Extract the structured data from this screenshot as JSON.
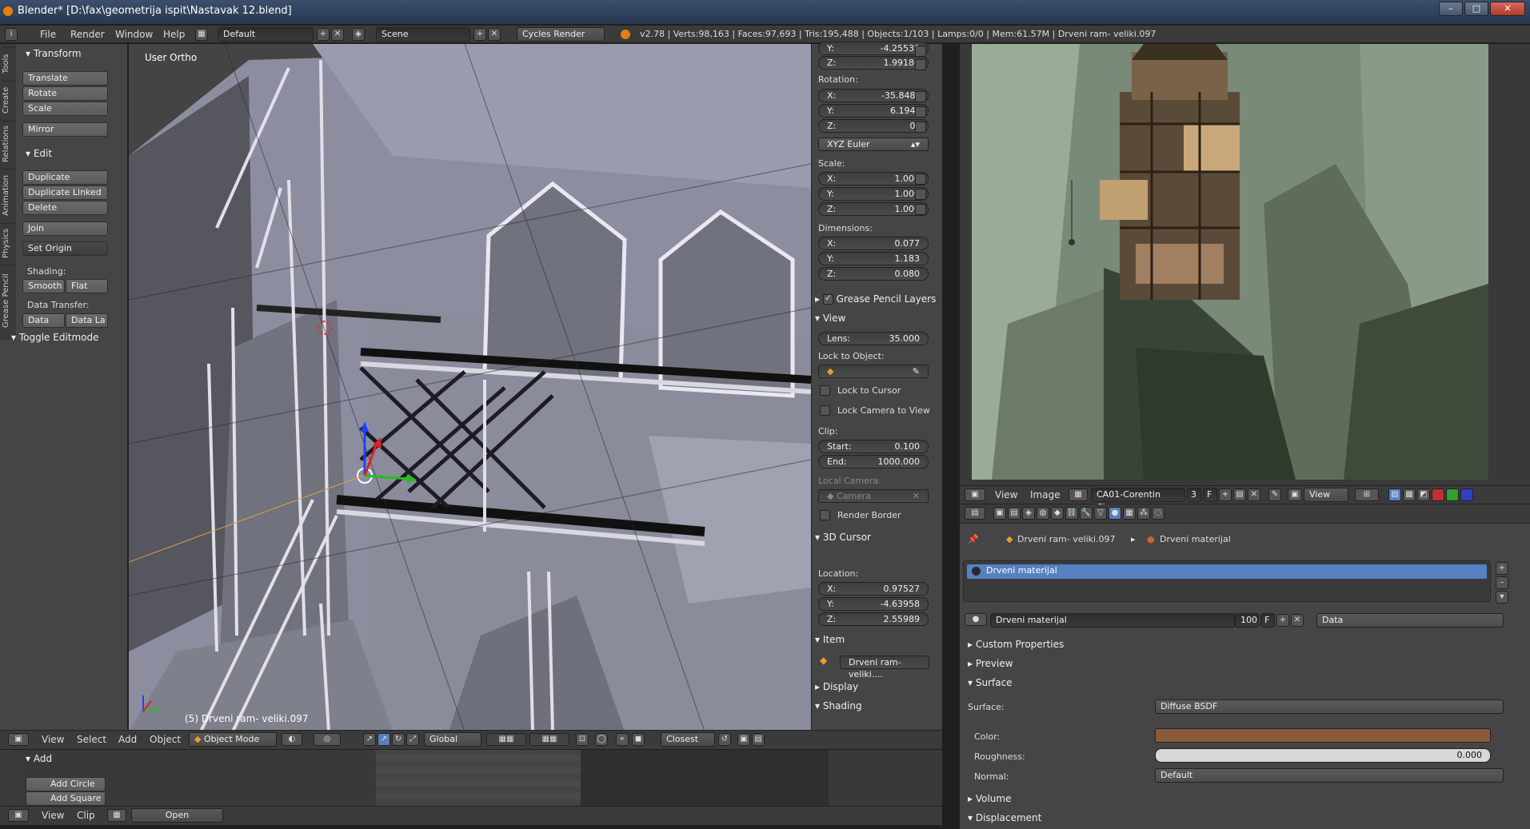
{
  "window": {
    "title": "Blender* [D:\\fax\\geometrija ispit\\Nastavak 12.blend]"
  },
  "infobar": {
    "menus": [
      "File",
      "Render",
      "Window",
      "Help"
    ],
    "layout": "Default",
    "scene": "Scene",
    "engine": "Cycles Render",
    "stats": "v2.78 | Verts:98,163 | Faces:97,693 | Tris:195,488 | Objects:1/103 | Lamps:0/0 | Mem:61.57M | Drveni ram- veliki.097"
  },
  "toolshelf": {
    "tabs": [
      "Tools",
      "Create",
      "Relations",
      "Animation",
      "Physics",
      "Grease Pencil"
    ],
    "transform_title": "Transform",
    "translate": "Translate",
    "rotate": "Rotate",
    "scale": "Scale",
    "mirror": "Mirror",
    "edit_title": "Edit",
    "duplicate": "Duplicate",
    "duplicate_linked": "Duplicate Linked",
    "delete": "Delete",
    "join": "Join",
    "set_origin": "Set Origin",
    "shading_label": "Shading:",
    "smooth": "Smooth",
    "flat": "Flat",
    "data_transfer_label": "Data Transfer:",
    "data": "Data",
    "data_la": "Data La",
    "toggle_editmode": "Toggle Editmode"
  },
  "viewport": {
    "view_label": "User Ortho",
    "object_label": "(5) Drveni ram- veliki.097"
  },
  "npanel": {
    "loc_y": {
      "k": "Y:",
      "v": "-4.25539"
    },
    "loc_z": {
      "k": "Z:",
      "v": "1.99180"
    },
    "rotation_label": "Rotation:",
    "rot_x": {
      "k": "X:",
      "v": "-35.848°"
    },
    "rot_y": {
      "k": "Y:",
      "v": "6.194°"
    },
    "rot_z": {
      "k": "Z:",
      "v": "0°"
    },
    "rot_mode": "XYZ Euler",
    "scale_label": "Scale:",
    "scl_x": {
      "k": "X:",
      "v": "1.000"
    },
    "scl_y": {
      "k": "Y:",
      "v": "1.000"
    },
    "scl_z": {
      "k": "Z:",
      "v": "1.000"
    },
    "dimensions_label": "Dimensions:",
    "dim_x": {
      "k": "X:",
      "v": "0.077"
    },
    "dim_y": {
      "k": "Y:",
      "v": "1.183"
    },
    "dim_z": {
      "k": "Z:",
      "v": "0.080"
    },
    "grease_pencil": "Grease Pencil Layers",
    "view_title": "View",
    "lens": {
      "k": "Lens:",
      "v": "35.000"
    },
    "lock_to_object": "Lock to Object:",
    "lock_to_cursor": "Lock to Cursor",
    "lock_camera": "Lock Camera to View",
    "clip_label": "Clip:",
    "clip_start": {
      "k": "Start:",
      "v": "0.100"
    },
    "clip_end": {
      "k": "End:",
      "v": "1000.000"
    },
    "local_camera": "Local Camera:",
    "camera": "Camera",
    "render_border": "Render Border",
    "cursor_title": "3D Cursor",
    "location_label": "Location:",
    "cur_x": {
      "k": "X:",
      "v": "0.97527"
    },
    "cur_y": {
      "k": "Y:",
      "v": "-4.63958"
    },
    "cur_z": {
      "k": "Z:",
      "v": "2.55989"
    },
    "item_title": "Item",
    "item_name": "Drveni ram- veliki....",
    "display_title": "Display",
    "shading_title": "Shading"
  },
  "vp_header": {
    "view": "View",
    "select": "Select",
    "add": "Add",
    "object": "Object",
    "mode": "Object Mode",
    "orientation": "Global",
    "snap": "Closest"
  },
  "bottom": {
    "add_title": "Add",
    "add_circle": "Add Circle",
    "add_square": "Add Square",
    "view": "View",
    "clip": "Clip",
    "open": "Open"
  },
  "img_header": {
    "view": "View",
    "image": "Image",
    "image_name": "CA01-Corentin Che...",
    "users": "3",
    "fake": "F",
    "view2": "View"
  },
  "props": {
    "object_name": "Drveni ram- veliki.097",
    "material_name": "Drveni materijal",
    "slot_item": "Drveni materijal",
    "mat_field": "Drveni materijal",
    "mat_users": "100",
    "mat_f": "F",
    "link": "Data",
    "custom_props": "Custom Properties",
    "preview": "Preview",
    "surface_title": "Surface",
    "surface_label": "Surface:",
    "surface_val": "Diffuse BSDF",
    "color_label": "Color:",
    "color_hex": "#8a5a3c",
    "roughness_label": "Roughness:",
    "roughness_val": "0.000",
    "normal_label": "Normal:",
    "normal_val": "Default",
    "volume": "Volume",
    "displacement": "Displacement"
  }
}
